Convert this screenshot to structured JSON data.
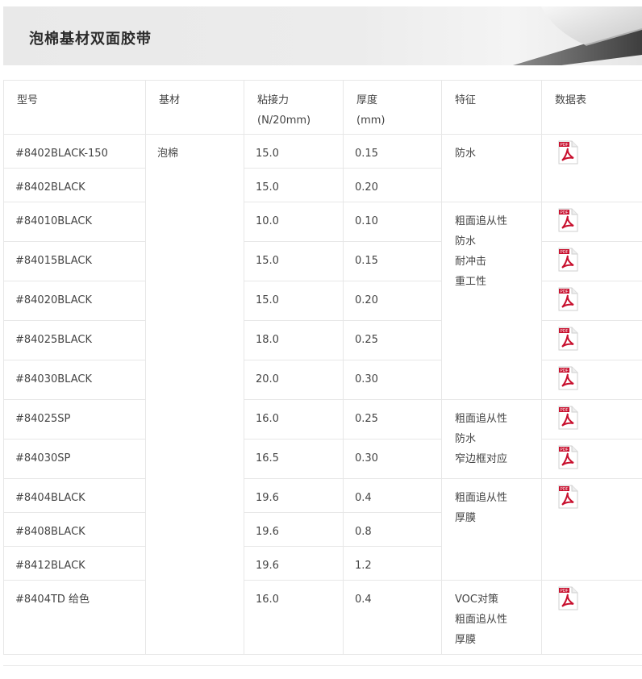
{
  "banner": {
    "title": "泡棉基材双面胶带"
  },
  "table": {
    "headers": {
      "model": "型号",
      "substrate": "基材",
      "adhesion_line1": "粘接力",
      "adhesion_line2": "(N/20mm)",
      "thickness_line1": "厚度",
      "thickness_line2": "(mm)",
      "features": "特征",
      "datasheet": "数据表"
    },
    "substrate": "泡棉",
    "rows": [
      {
        "model": "#8402BLACK-150",
        "adhesion": "15.0",
        "thickness": "0.15"
      },
      {
        "model": "#8402BLACK",
        "adhesion": "15.0",
        "thickness": "0.20"
      },
      {
        "model": "#84010BLACK",
        "adhesion": "10.0",
        "thickness": "0.10"
      },
      {
        "model": "#84015BLACK",
        "adhesion": "15.0",
        "thickness": "0.15"
      },
      {
        "model": "#84020BLACK",
        "adhesion": "15.0",
        "thickness": "0.20"
      },
      {
        "model": "#84025BLACK",
        "adhesion": "18.0",
        "thickness": "0.25"
      },
      {
        "model": "#84030BLACK",
        "adhesion": "20.0",
        "thickness": "0.30"
      },
      {
        "model": "#84025SP",
        "adhesion": "16.0",
        "thickness": "0.25"
      },
      {
        "model": "#84030SP",
        "adhesion": "16.5",
        "thickness": "0.30"
      },
      {
        "model": "#8404BLACK",
        "adhesion": "19.6",
        "thickness": "0.4"
      },
      {
        "model": "#8408BLACK",
        "adhesion": "19.6",
        "thickness": "0.8"
      },
      {
        "model": "#8412BLACK",
        "adhesion": "19.6",
        "thickness": "1.2"
      },
      {
        "model": "#8404TD 给色",
        "adhesion": "16.0",
        "thickness": "0.4"
      }
    ],
    "feature_groups": [
      [
        "防水"
      ],
      [
        "粗面追从性",
        "防水",
        "耐冲击",
        "重工性"
      ],
      [
        "粗面追从性",
        "防水",
        "窄边框对应"
      ],
      [
        "粗面追从性",
        "厚膜"
      ],
      [
        "VOC对策",
        "粗面追从性",
        "厚膜"
      ]
    ],
    "pdf_icon_label": "PDF"
  },
  "colors": {
    "pdf_red": "#c8102e",
    "border": "#e7e7e7"
  }
}
